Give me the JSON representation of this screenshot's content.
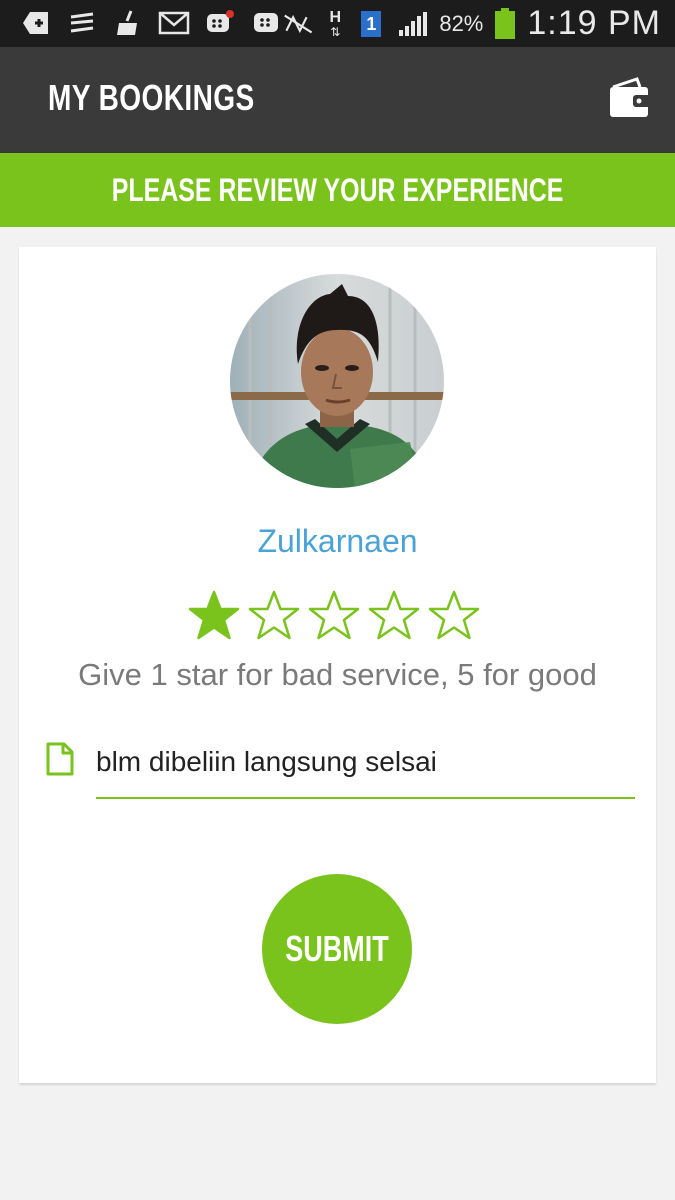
{
  "status_bar": {
    "icons": [
      "add-box-icon",
      "swipe-icon",
      "cleaner-icon",
      "mail-icon",
      "bbm-notification-icon",
      "bbm-icon",
      "no-sim-icon",
      "h-data-icon",
      "notification-1-icon",
      "signal-icon",
      "battery-icon"
    ],
    "h_indicator": "H",
    "badge_number": "1",
    "battery_percent": "82%",
    "time": "1:19 PM"
  },
  "app_bar": {
    "title": "MY BOOKINGS",
    "action_icon": "wallet-icon"
  },
  "banner": {
    "text": "PLEASE REVIEW YOUR EXPERIENCE"
  },
  "review": {
    "driver_name": "Zulkarnaen",
    "rating": 1,
    "max_rating": 5,
    "hint": "Give 1 star for bad service, 5 for good",
    "comment": "blm dibeliin langsung selsai",
    "submit_label": "SUBMIT"
  },
  "colors": {
    "accent_green": "#7ac31c",
    "app_bar": "#3a3a3a",
    "status_bar": "#1c1c1c",
    "name_blue": "#4aa3d6",
    "background": "#f2f2f2"
  }
}
